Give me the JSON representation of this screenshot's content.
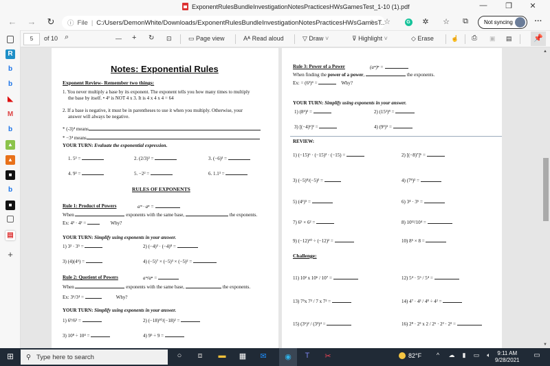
{
  "window": {
    "doc_title": "ExponentRulesBundleInvestigationNotesPracticesHWsGamesTest_1-10 (1).pdf",
    "controls": {
      "minimize": "—",
      "restore": "❐",
      "close": "✕"
    }
  },
  "navbar": {
    "back": "←",
    "forward": "→",
    "refresh": "↻",
    "site_info": "ⓘ",
    "scheme": "File",
    "url": "C:/Users/DemonWhite/Downloads/ExponentRulesBundleInvestigationNotesPracticesHWsGamesT...",
    "sync_label": "Not syncing",
    "more": "···"
  },
  "pdf_toolbar": {
    "page_current": "5",
    "page_total": "of 10",
    "zoom_out": "—",
    "zoom_in": "+",
    "page_view": "Page view",
    "read_aloud": "Read aloud",
    "draw": "Draw",
    "highlight": "Highlight",
    "erase": "Erase"
  },
  "left_page": {
    "title": "Notes:  Exponential Rules",
    "review_heading": "Exponent Review- Remember two things:",
    "point1_a": "1. You never multiply a base by its exponent. The exponent tells you how many times to multiply",
    "point1_b": "the base by itself.  •  4³ is NOT 4 x 3. It is 4 x 4 x 4 = 64",
    "point2_a": "2.  If a base is negative, it must be in parentheses to use it when you multiply. Otherwise, your",
    "point2_b": "answer will always be negative.",
    "means1": "* (-3)⁴ means",
    "means2": "* −3⁴ means",
    "your_turn_1_bold": "YOUR TURN:",
    "your_turn_1_italic": "Evaluate the exponential expression.",
    "evaluate": [
      "1.  5³ =",
      "2.  (2/3)³ =",
      "3. (−6)³ =",
      "4.  9³  =",
      "5.  −2²  =",
      "6.    1.1³ ="
    ],
    "rules_heading": "RULES OF EXPONENTS",
    "rule1_name": "Rule 1:  Product of Powers",
    "rule1_formula": "aᵐ · aⁿ =",
    "rule1_when_a": "When",
    "rule1_when_b": "exponents with the same base,",
    "rule1_when_c": "the exponents.",
    "rule1_ex": "Ex:   4³ · 4² =",
    "why": "Why?",
    "your_turn_bold": "YOUR TURN:",
    "your_turn_italic": "Simplify using exponents in your answer.",
    "rule1_problems": [
      "1)  3² · 3⁵ =",
      "2)  (−4)³  ·  (−4)⁸ =",
      "3)  (4)(4⁶) =",
      "4)  (−5)⁷ × (−5)³ × (−5)² ="
    ],
    "rule2_name": "Rule 2:  Quotient of Powers",
    "rule2_formula": "aᵐ/aⁿ =",
    "rule2_when_b": "exponents with the same base,",
    "rule2_when_c": "the exponents.",
    "rule2_ex": "Ex:   3⁶/3⁴ =",
    "rule2_problems": [
      "1)   6⁹/6³ =",
      "2)  (−18)¹⁰/(−18)² =",
      "3)   10⁸ ÷ 10⁴ =",
      "4)   9⁵ ÷ 9 ="
    ]
  },
  "right_page": {
    "rule3_name": "Rule 3:  Power of a Power",
    "rule3_formula": "(aᵐ)ⁿ =",
    "rule3_when_a": "When finding the",
    "rule3_when_bold": "power of a power",
    "rule3_when_c": "the exponents.",
    "rule3_ex": "Ex:   =   (6³)⁴ =",
    "why": "Why?",
    "your_turn_bold": "YOUR TURN:",
    "your_turn_italic": "Simplify using exponents in your answer.",
    "rule3_problems": [
      "1)     (8⁴)³ =",
      "2)  (15²)⁸ =",
      "3)    [(−4)⁶]² =",
      "4)   (9³)⁵ ="
    ],
    "review_heading": "REVIEW:",
    "review_problems": [
      "1)  (−15)⁶ · (−15)³ · (−15) =",
      "2)    [(−8)⁷]⁶ =",
      "3)   (−5)⁸/(−5)³ =",
      "4)    (7⁸)²   =",
      "5)   (4¹)⁵ =",
      "6)    3⁴ · 3⁶ =",
      "7)    6⁵ × 6² =",
      "8)     10¹²/10⁴ =",
      "9)    (−12)¹⁰ ÷ (−12)² =",
      "10)   8⁵ × 8 ="
    ],
    "challenge_heading": "Challenge:",
    "challenge_problems": [
      "11)   10² x 10⁶ / 10⁷ =",
      "12)    5⁴ · 5⁶ / 5⁴ =",
      "13)  7⁵x 7³ / 7 x 7² =",
      "14)   4⁷ · 4³ / 4⁸ ÷ 4² =",
      "15)   (3⁶)² / (3³)⁴ =",
      "16)   2⁸ · 2³ x 2 / 2⁶ · 2³ · 2² ="
    ]
  },
  "taskbar": {
    "search_placeholder": "Type here to search",
    "weather": "82°F",
    "time": "9:11 AM",
    "date": "9/28/2021"
  }
}
